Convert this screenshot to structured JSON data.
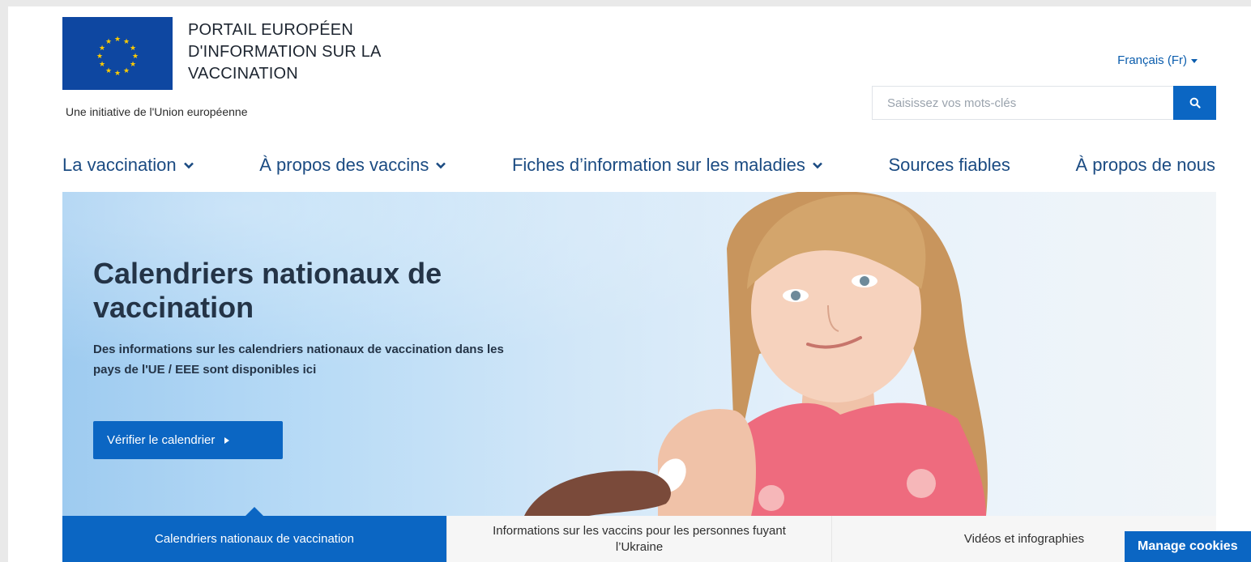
{
  "header": {
    "site_title": "PORTAIL EUROPÉEN D'INFORMATION SUR LA VACCINATION",
    "tagline": "Une initiative de l'Union européenne",
    "language": "Français (Fr)",
    "search": {
      "placeholder": "Saisissez vos mots-clés",
      "icon": "search-icon"
    }
  },
  "nav": {
    "items": [
      {
        "label": "La vaccination",
        "has_dropdown": true
      },
      {
        "label": "À propos des vaccins",
        "has_dropdown": true
      },
      {
        "label": "Fiches d’information sur les maladies",
        "has_dropdown": true
      },
      {
        "label": "Sources fiables",
        "has_dropdown": false
      },
      {
        "label": "À propos de nous",
        "has_dropdown": false
      }
    ]
  },
  "hero": {
    "title": "Calendriers nationaux de vaccination",
    "text": "Des informations sur les calendriers nationaux de vaccination dans les pays de l'UE / EEE sont disponibles ici",
    "button_label": "Vérifier le calendrier"
  },
  "tabs": [
    {
      "label": "Calendriers nationaux de vaccination",
      "active": true
    },
    {
      "label": "Informations sur les vaccins pour les personnes fuyant l’Ukraine",
      "active": false
    },
    {
      "label": "Vidéos et infographies",
      "active": false
    }
  ],
  "cookie_button": "Manage cookies",
  "colors": {
    "primary_blue": "#0b66c3",
    "eu_flag_blue": "#0e47a1",
    "eu_star_yellow": "#ffcc00",
    "nav_text": "#1b4b82"
  }
}
